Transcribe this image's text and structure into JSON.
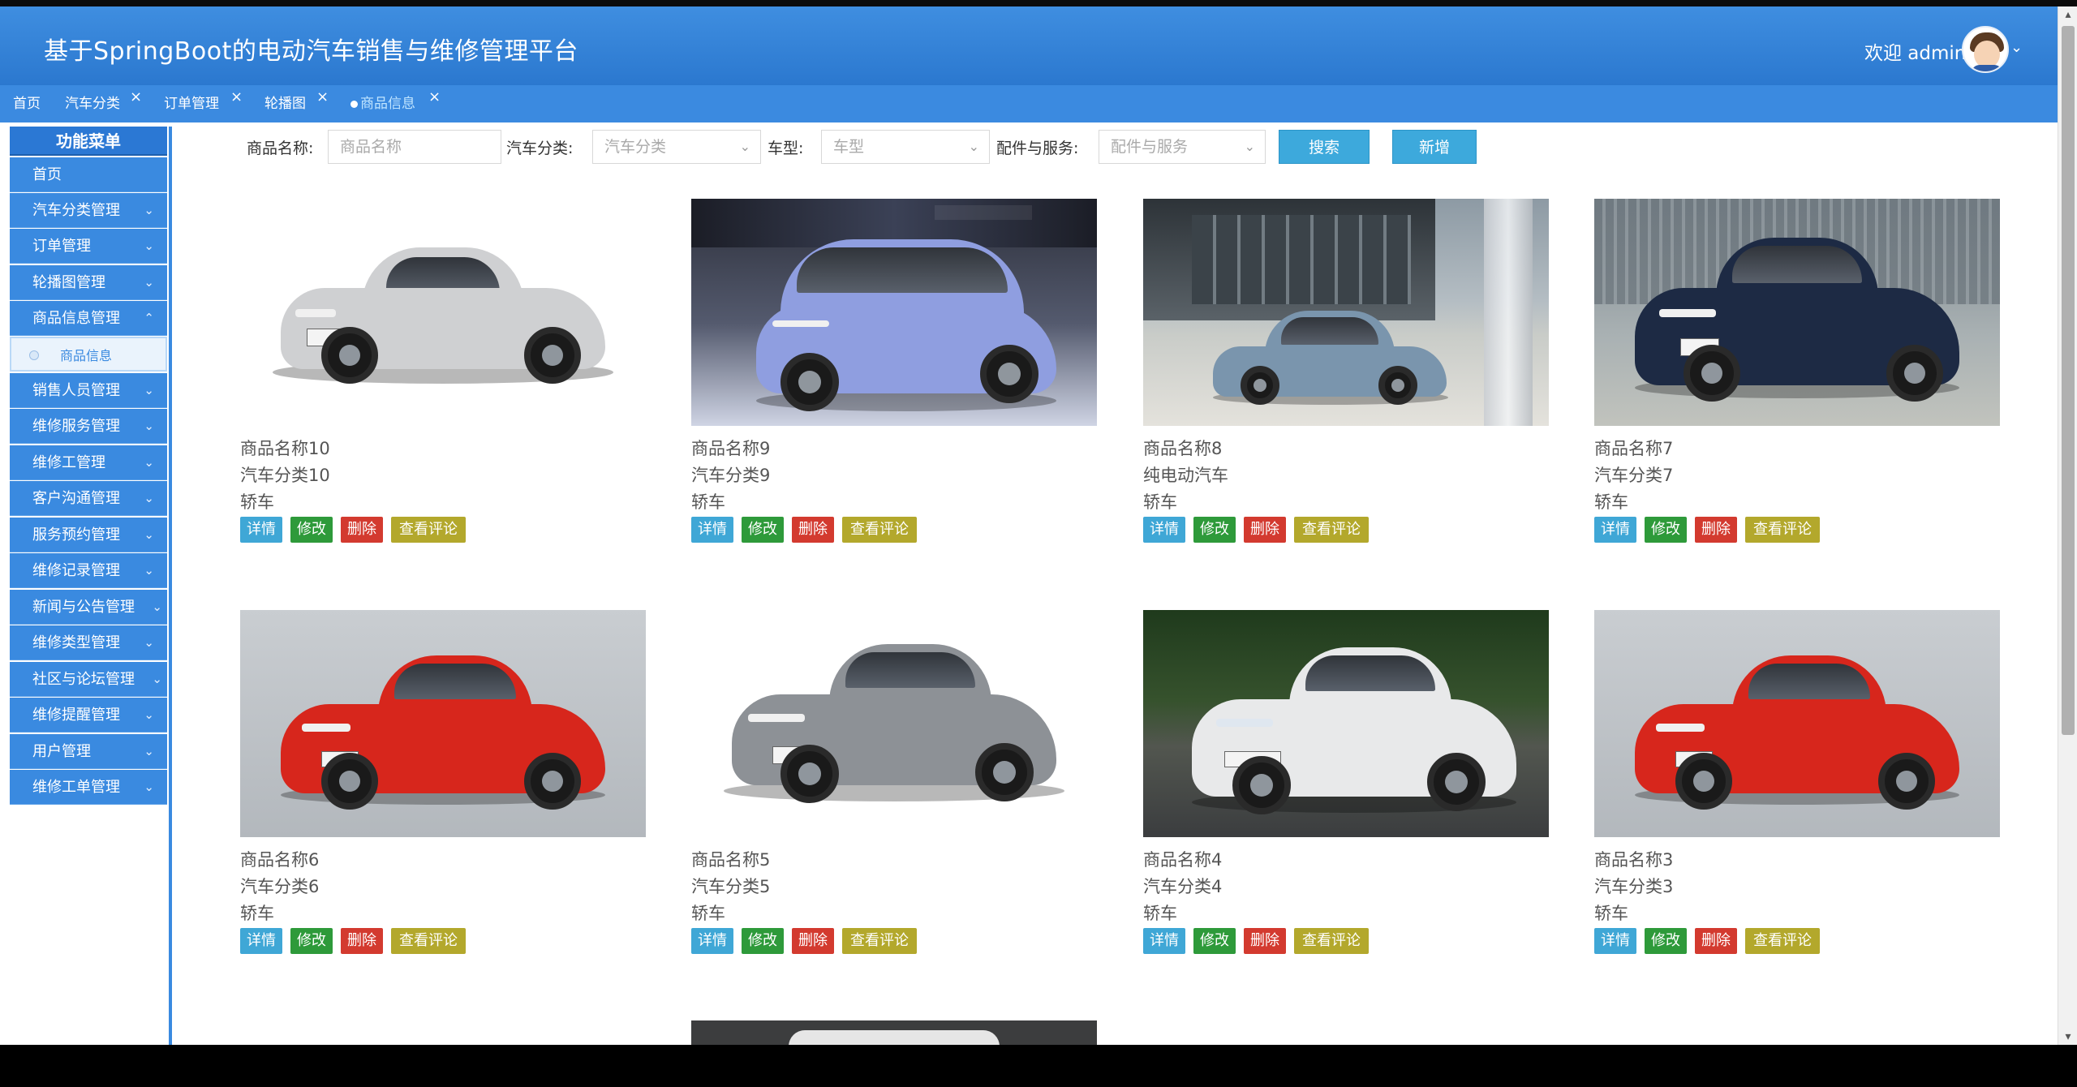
{
  "header": {
    "title": "基于SpringBoot的电动汽车销售与维修管理平台",
    "welcome": "欢迎 admin"
  },
  "tabs": [
    {
      "label": "首页"
    },
    {
      "label": "汽车分类"
    },
    {
      "label": "订单管理"
    },
    {
      "label": "轮播图"
    },
    {
      "label": "商品信息",
      "active": true
    }
  ],
  "sidebar": {
    "title": "功能菜单",
    "items": [
      {
        "label": "首页"
      },
      {
        "label": "汽车分类管理"
      },
      {
        "label": "订单管理"
      },
      {
        "label": "轮播图管理"
      },
      {
        "label": "商品信息管理",
        "expanded": true
      },
      {
        "label": "商品信息",
        "sub": true,
        "active": true
      },
      {
        "label": "销售人员管理"
      },
      {
        "label": "维修服务管理"
      },
      {
        "label": "维修工管理"
      },
      {
        "label": "客户沟通管理"
      },
      {
        "label": "服务预约管理"
      },
      {
        "label": "维修记录管理"
      },
      {
        "label": "新闻与公告管理"
      },
      {
        "label": "维修类型管理"
      },
      {
        "label": "社区与论坛管理"
      },
      {
        "label": "维修提醒管理"
      },
      {
        "label": "用户管理"
      },
      {
        "label": "维修工单管理"
      }
    ]
  },
  "search": {
    "name_label": "商品名称:",
    "name_placeholder": "商品名称",
    "category_label": "汽车分类:",
    "category_placeholder": "汽车分类",
    "type_label": "车型:",
    "type_placeholder": "车型",
    "parts_label": "配件与服务:",
    "parts_placeholder": "配件与服务",
    "search_button": "搜索",
    "add_button": "新增"
  },
  "card_actions": {
    "detail": "详情",
    "edit": "修改",
    "delete": "删除",
    "reviews": "查看评论"
  },
  "products": [
    {
      "name": "商品名称10",
      "category": "汽车分类10",
      "type": "轿车",
      "car_color": "#cfd0d2"
    },
    {
      "name": "商品名称9",
      "category": "汽车分类9",
      "type": "轿车",
      "car_color": "#8f9ee0"
    },
    {
      "name": "商品名称8",
      "category": "纯电动汽车",
      "type": "轿车",
      "car_color": "#7a95ad"
    },
    {
      "name": "商品名称7",
      "category": "汽车分类7",
      "type": "轿车",
      "car_color": "#1d2a44"
    },
    {
      "name": "商品名称6",
      "category": "汽车分类6",
      "type": "轿车",
      "car_color": "#d7261c"
    },
    {
      "name": "商品名称5",
      "category": "汽车分类5",
      "type": "轿车",
      "car_color": "#8d9196"
    },
    {
      "name": "商品名称4",
      "category": "汽车分类4",
      "type": "轿车",
      "car_color": "#e8e9ea"
    },
    {
      "name": "商品名称3",
      "category": "汽车分类3",
      "type": "轿车",
      "car_color": "#d7261c"
    }
  ],
  "icons": {
    "tab_close": "close-icon",
    "chevron": "chevron-down-icon",
    "user_caret": "chevron-down-icon"
  },
  "colors": {
    "header": "#2b78cf",
    "accent": "#3a8ae0",
    "detail": "#3fa7d6",
    "edit": "#2e9a3a",
    "delete": "#d33a2f",
    "reviews": "#b3a82c"
  }
}
